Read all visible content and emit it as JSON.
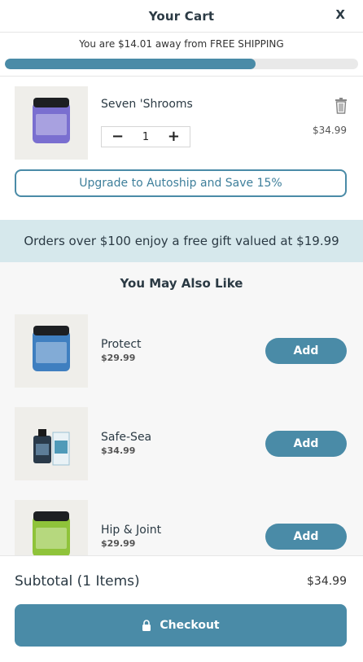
{
  "header": {
    "title": "Your Cart",
    "close_label": "X"
  },
  "shipping": {
    "message": "You are $14.01 away from FREE SHIPPING",
    "progress": 0.71
  },
  "cart_item": {
    "name": "Seven 'Shrooms",
    "quantity": "1",
    "minus": "−",
    "plus": "+",
    "price": "$34.99",
    "icon": "trash-icon"
  },
  "autoship_label": "Upgrade to Autoship and Save 15%",
  "promo_text": "Orders over $100 enjoy a free gift valued at $19.99",
  "recommendations": {
    "title": "You May Also Like",
    "add_label": "Add",
    "items": [
      {
        "name": "Protect",
        "price": "$29.99",
        "color": "#3f7fc0"
      },
      {
        "name": "Safe-Sea",
        "price": "$34.99",
        "color": "#4f9ab8"
      },
      {
        "name": "Hip & Joint",
        "price": "$29.99",
        "color": "#8fc33a"
      }
    ]
  },
  "footer": {
    "subtotal_label": "Subtotal (1 Items)",
    "subtotal_value": "$34.99",
    "checkout_label": "Checkout",
    "icon": "lock-icon"
  },
  "colors": {
    "accent": "#4a8ba7",
    "promo_bg": "#d6e8ec",
    "cart_jar": "#7a6fd0"
  }
}
